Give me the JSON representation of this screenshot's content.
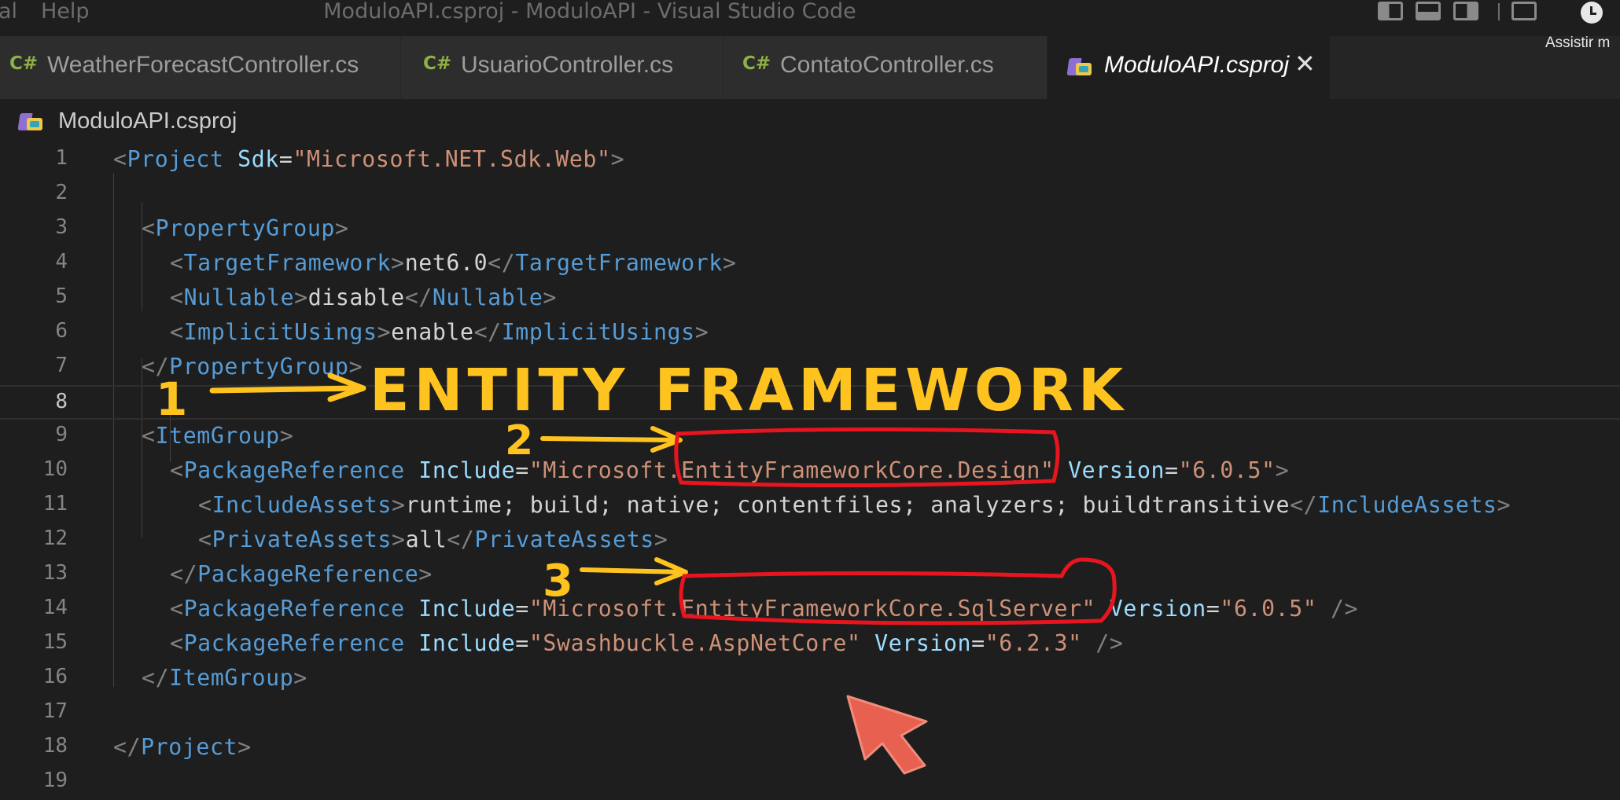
{
  "titlebar": {
    "menu": [
      {
        "label": "al"
      },
      {
        "label": "Help"
      }
    ],
    "title": "ModuloAPI.csproj - ModuloAPI - Visual Studio Code",
    "watch_later": "Assistir m"
  },
  "tabs": [
    {
      "icon": "C#",
      "label": "WeatherForecastController.cs",
      "active": false
    },
    {
      "icon": "C#",
      "label": "UsuarioController.cs",
      "active": false
    },
    {
      "icon": "C#",
      "label": "ContatoController.cs",
      "active": false
    },
    {
      "icon": "msbuild-project-icon",
      "label": "ModuloAPI.csproj",
      "active": true,
      "close": "✕"
    }
  ],
  "breadcrumb": {
    "file": "ModuloAPI.csproj"
  },
  "editor": {
    "current_line": 8,
    "lines": [
      {
        "n": "1"
      },
      {
        "n": "2"
      },
      {
        "n": "3"
      },
      {
        "n": "4"
      },
      {
        "n": "5"
      },
      {
        "n": "6"
      },
      {
        "n": "7"
      },
      {
        "n": "8"
      },
      {
        "n": "9"
      },
      {
        "n": "10"
      },
      {
        "n": "11"
      },
      {
        "n": "12"
      },
      {
        "n": "13"
      },
      {
        "n": "14"
      },
      {
        "n": "15"
      },
      {
        "n": "16"
      },
      {
        "n": "17"
      },
      {
        "n": "18"
      },
      {
        "n": "19"
      }
    ],
    "tokens": {
      "lt": "<",
      "gt": ">",
      "lts": "</",
      "selfclose": " />",
      "eq": "=",
      "project": "Project",
      "sdk_attr": "Sdk",
      "sdk_val": "\"Microsoft.NET.Sdk.Web\"",
      "property_group": "PropertyGroup",
      "target_framework": "TargetFramework",
      "target_framework_val": "net6.0",
      "nullable": "Nullable",
      "nullable_val": "disable",
      "implicit_usings": "ImplicitUsings",
      "implicit_usings_val": "enable",
      "item_group": "ItemGroup",
      "package_reference": "PackageReference",
      "include": "Include",
      "version": "Version",
      "pkg1_name": "\"Microsoft.EntityFrameworkCore.Design\"",
      "pkg1_version": "\"6.0.5\"",
      "include_assets": "IncludeAssets",
      "include_assets_val": "runtime; build; native; contentfiles; analyzers; buildtransitive",
      "private_assets": "PrivateAssets",
      "private_assets_val": "all",
      "pkg2_name": "\"Microsoft.EntityFrameworkCore.SqlServer\"",
      "pkg2_version": "\"6.0.5\"",
      "pkg3_name": "\"Swashbuckle.AspNetCore\"",
      "pkg3_version": "\"6.2.3\""
    }
  },
  "annotations": {
    "marker_1": "1",
    "heading": "ENTITY FRAMEWORK",
    "marker_2": "2",
    "marker_3": "3",
    "stroke_color": "#ffc320",
    "highlight_color": "#e8141e",
    "cursor_color": "#e8604f"
  }
}
